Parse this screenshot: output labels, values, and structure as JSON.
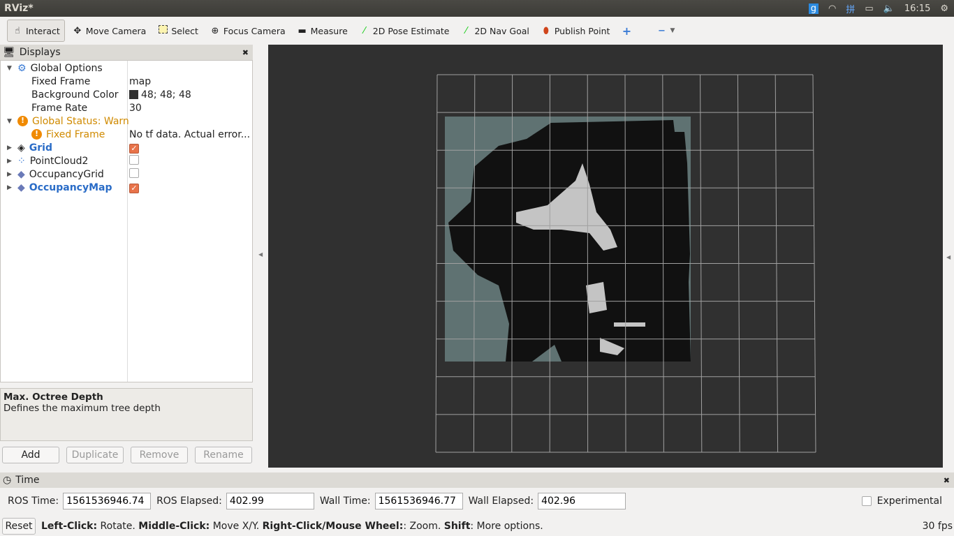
{
  "window": {
    "title": "RViz*",
    "clock": "16:15"
  },
  "toolbar": {
    "tools": [
      {
        "label": "Interact",
        "icon": "hand-icon",
        "active": true
      },
      {
        "label": "Move Camera",
        "icon": "move-camera-icon"
      },
      {
        "label": "Select",
        "icon": "select-icon"
      },
      {
        "label": "Focus Camera",
        "icon": "focus-camera-icon"
      },
      {
        "label": "Measure",
        "icon": "ruler-icon"
      },
      {
        "label": "2D Pose Estimate",
        "icon": "green-arrow-icon"
      },
      {
        "label": "2D Nav Goal",
        "icon": "green-arrow-icon"
      },
      {
        "label": "Publish Point",
        "icon": "map-pin-icon"
      }
    ]
  },
  "displays": {
    "title": "Displays",
    "global_options": "Global Options",
    "fixed_frame_label": "Fixed Frame",
    "fixed_frame_value": "map",
    "bg_label": "Background Color",
    "bg_value": "48; 48; 48",
    "frame_rate_label": "Frame Rate",
    "frame_rate_value": "30",
    "status": "Global Status: Warn",
    "status_child": "Fixed Frame",
    "status_child_value": "No tf data.  Actual error...",
    "items": [
      {
        "label": "Grid",
        "checked": true,
        "highlight": true
      },
      {
        "label": "PointCloud2",
        "checked": false,
        "highlight": false
      },
      {
        "label": "OccupancyGrid",
        "checked": false,
        "highlight": false
      },
      {
        "label": "OccupancyMap",
        "checked": true,
        "highlight": true
      }
    ]
  },
  "description": {
    "title": "Max. Octree Depth",
    "text": "Defines the maximum tree depth"
  },
  "buttons": {
    "add": "Add",
    "duplicate": "Duplicate",
    "remove": "Remove",
    "rename": "Rename"
  },
  "time": {
    "title": "Time",
    "ros_time_label": "ROS Time:",
    "ros_time": "1561536946.74",
    "ros_elapsed_label": "ROS Elapsed:",
    "ros_elapsed": "402.99",
    "wall_time_label": "Wall Time:",
    "wall_time": "1561536946.77",
    "wall_elapsed_label": "Wall Elapsed:",
    "wall_elapsed": "402.96",
    "experimental": "Experimental"
  },
  "status": {
    "reset": "Reset",
    "lc": "Left-Click:",
    "lc_t": " Rotate. ",
    "mc": "Middle-Click:",
    "mc_t": " Move X/Y. ",
    "rc": "Right-Click/Mouse Wheel:",
    "rc_t": ": Zoom. ",
    "sh": "Shift",
    "sh_t": ": More options.",
    "fps": "30 fps"
  },
  "colors": {
    "background": "#303030",
    "map_unknown": "#5f7272",
    "map_occupied": "#111111",
    "map_free": "#c4c4c4",
    "grid": "#a0a0a0"
  }
}
